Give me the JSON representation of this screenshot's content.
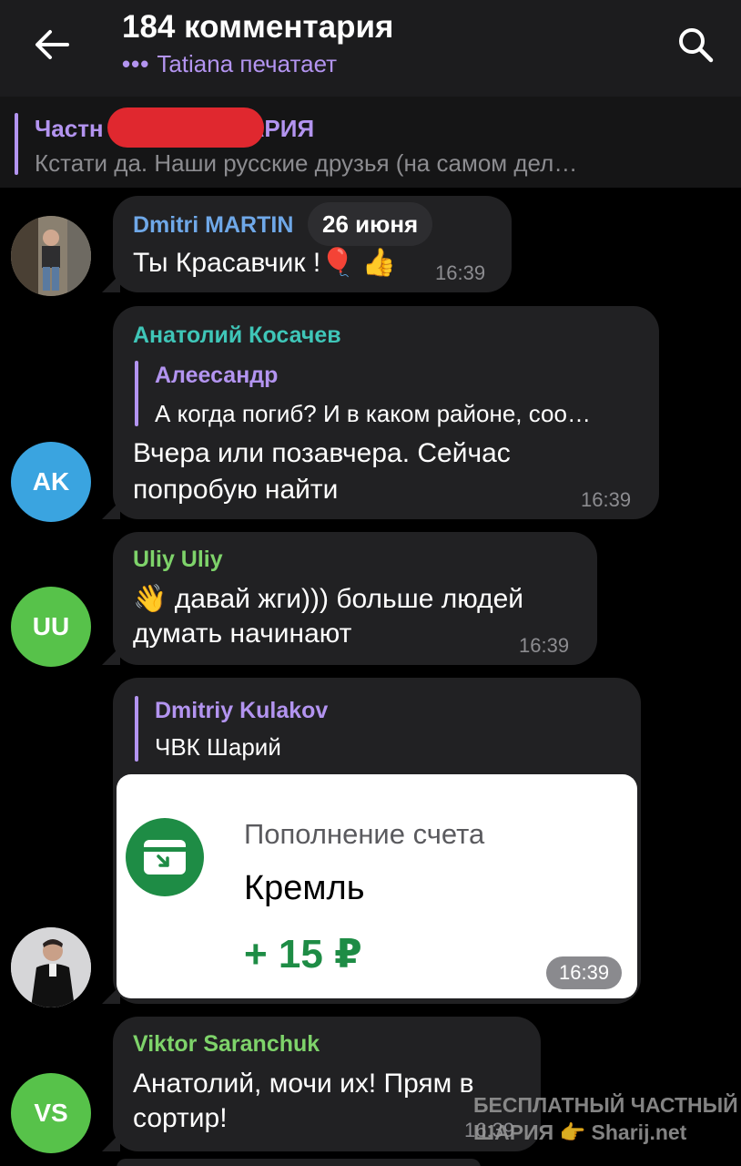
{
  "header": {
    "title": "184 комментария",
    "typing_dots": "•••",
    "typing_text": "Tatiana печатает",
    "back_icon": "arrow-left-icon",
    "search_icon": "search-icon"
  },
  "pinned": {
    "title_start": "Частн",
    "title_end": "АРИЯ",
    "text": "Кстати да. Наши русские друзья (на самом дел…"
  },
  "date_pill": "26 июня",
  "messages": [
    {
      "author": "Dmitri MARTIN",
      "author_color": "#6fa8e8",
      "text": "Ты Красавчик !🎈 👍",
      "time": "16:39"
    },
    {
      "author": "Анатолий Косачев",
      "author_color": "#3fc6b8",
      "avatar_initials": "AK",
      "avatar_color": "#3aa4e0",
      "reply_name": "Алеесандр",
      "reply_text": "А когда погиб? И в каком районе, соо…",
      "text_line1": "Вчера или позавчера. Сейчас",
      "text_line2": "попробую найти",
      "time": "16:39"
    },
    {
      "author": "Uliy Uliy",
      "author_color": "#7ed36a",
      "avatar_initials": "UU",
      "avatar_color": "#57c24a",
      "text_line1": "👋 давай жги))) больше людей",
      "text_line2": "думать начинают",
      "time": "16:39"
    },
    {
      "reply_name": "Dmitriy Kulakov",
      "reply_text": "ЧВК Шарий",
      "card_label": "Пополнение счета",
      "card_name": "Кремль",
      "card_amount": "+ 15 ₽",
      "time": "16:39"
    },
    {
      "author": "Viktor Saranchuk",
      "author_color": "#7ed36a",
      "avatar_initials": "VS",
      "avatar_color": "#57c24a",
      "text_line1": "Анатолий, мочи их! Прям в",
      "text_line2": "сортир!",
      "time": "16:39"
    }
  ],
  "watermark": {
    "line1": "БЕСПЛАТНЫЙ ЧАСТНЫЙ",
    "line2": "ШАРИЯ 👉 Sharij.net"
  }
}
